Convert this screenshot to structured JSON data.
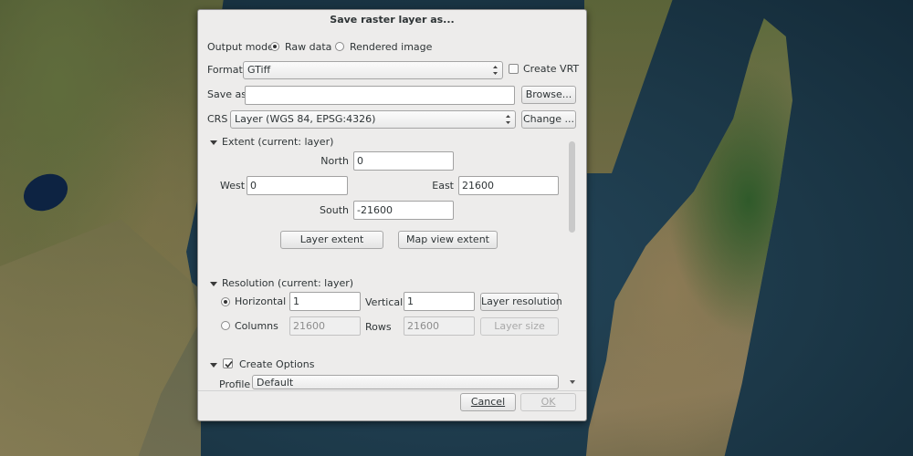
{
  "dialog": {
    "title": "Save raster layer as...",
    "output_mode": {
      "label": "Output mode",
      "options": [
        "Raw data",
        "Rendered image"
      ],
      "selected": "Raw data"
    },
    "format": {
      "label": "Format",
      "value": "GTiff",
      "create_vrt_label": "Create VRT",
      "create_vrt_checked": false
    },
    "save_as": {
      "label": "Save as",
      "value": "",
      "browse_label": "Browse..."
    },
    "crs": {
      "label": "CRS",
      "value": "Layer (WGS 84, EPSG:4326)",
      "change_label": "Change ..."
    },
    "extent": {
      "header": "Extent (current: layer)",
      "north_label": "North",
      "north": "0",
      "west_label": "West",
      "west": "0",
      "east_label": "East",
      "east": "21600",
      "south_label": "South",
      "south": "-21600",
      "layer_extent_label": "Layer extent",
      "map_view_extent_label": "Map view extent"
    },
    "resolution": {
      "header": "Resolution (current: layer)",
      "horizontal_label": "Horizontal",
      "horizontal": "1",
      "vertical_label": "Vertical",
      "vertical": "1",
      "layer_resolution_label": "Layer resolution",
      "columns_label": "Columns",
      "columns": "21600",
      "rows_label": "Rows",
      "rows": "21600",
      "layer_size_label": "Layer size",
      "selected": "Horizontal"
    },
    "create_options": {
      "label": "Create Options",
      "checked": true,
      "profile_label": "Profile",
      "profile_value": "Default"
    },
    "buttons": {
      "cancel": "Cancel",
      "ok": "OK"
    }
  },
  "colors": {
    "dialog_bg": "#edeceb",
    "text": "#2e3436",
    "disabled_text": "#a8a8a8"
  }
}
